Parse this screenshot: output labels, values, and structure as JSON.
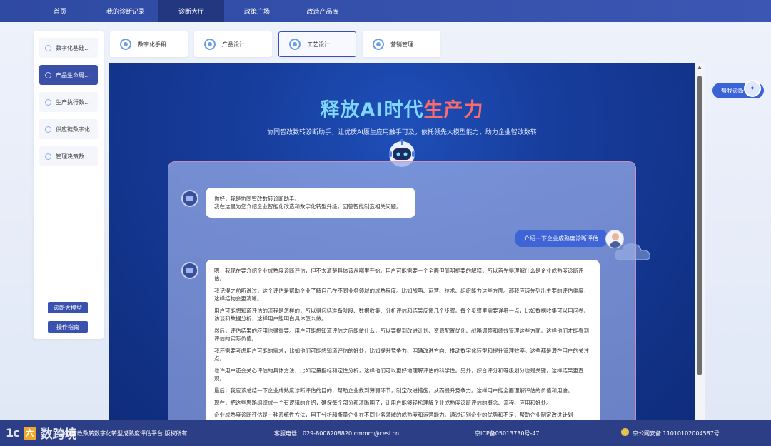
{
  "nav": {
    "items": [
      "首页",
      "我的诊断记录",
      "诊断大厅",
      "政策广场",
      "改造产品库"
    ],
    "active_index": 2
  },
  "sidebar": {
    "items": [
      {
        "label": "数字化基础…"
      },
      {
        "label": "产品生命周…"
      },
      {
        "label": "生产执行数…"
      },
      {
        "label": "供应链数字化"
      },
      {
        "label": "管理决策数…"
      }
    ],
    "active_index": 1,
    "model_button": "诊断大模型",
    "guide_button": "操作指南"
  },
  "tabs": {
    "items": [
      "数字化手段",
      "产品设计",
      "工艺设计",
      "营销管理"
    ],
    "active_index": 2
  },
  "hero": {
    "title_part1": "释放AI时代",
    "title_part2": "生产力",
    "subtitle": "协同智改数转诊断助手，让优质AI原生应用触手可及，依托领先大模型能力，助力企业智改数转"
  },
  "chat": {
    "greeting": [
      "你好，我是协同智改数转诊断助手。",
      "我在这里为您介绍企业智能化改造和数字化转型升级，回答智能制造相关问题。"
    ],
    "user_message": "介绍一下企业成熟度诊断评估",
    "answer": [
      "嗯，我现在要介绍企业成熟度诊断评估，但不太清楚具体该从哪里开始。用户可能需要一个全面但简明扼要的解释，所以首先得理解什么是企业成熟度诊断评估。",
      "我记得之前听说过，这个评估是帮助企业了解自己在不同业务领域的成熟程度。比如战略、运营、技术、组织能力这些方面。那我应该先列出主要的评估维度，这样结构会更清晰。",
      "用户可能想知道评估的流程是怎样的，所以得包括准备阶段、数据收集、分析评估和结果反馈几个步骤。每个步骤里需要详细一点，比如数据收集可以用问卷、访谈和数据分析，这样用户能明白具体怎么做。",
      "然后，评估结果的应用也很重要。用户可能想知道评估之后能做什么，所以要提到改进计划、资源配置优化、战略调整和绩效管理这些方面。这样他们才能看到评估的实际价值。",
      "我还需要考虑用户可能的需求，比如他们可能想知道评估的好处，比如提升竞争力、明确改进方向、推动数字化转型和提升管理效率。这些都是潜在用户的关注点。",
      "也许用户还会关心评估的具体方法，比如定量指标和定性分析，这样他们可以更好地理解评估的科学性。另外，综合评分和等级划分也是关键，这样结果更直观。",
      "最后，我应该总结一下企业成熟度诊断评估的目的，帮助企业找到薄弱环节，制定改进措施，从而提升竞争力。这样用户能全面理解评估的价值和用途。",
      "现在，把这些思路组织成一个有逻辑的介绍，确保每个部分都清晰明了，让用户能够轻松理解企业成熟度诊断评估的概念、流程、应用和好处。",
      "企业成熟度诊断评估是一种系统性方法，用于分析和衡量企业在不同业务领域的成熟度和运营能力。通过识别企业的优势和不足，帮助企业制定改进计划"
    ]
  },
  "help_button": "帮我诊断",
  "footer": {
    "copyright": "协同智改数转数字化转型成熟度评估平台 版权所有",
    "contact": "客服电话：029-8008208820  cmmm@cesi.cn",
    "icp": "京ICP备05013730号-47",
    "police": "京公网安备 11010102004587号"
  },
  "watermark": {
    "logo": "1c",
    "text": "数跨境"
  }
}
